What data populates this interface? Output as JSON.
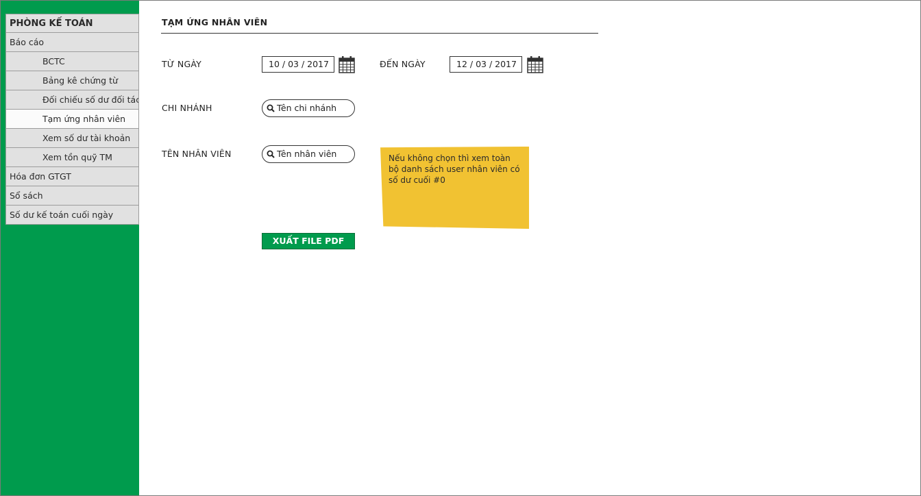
{
  "sidebar": {
    "items": [
      {
        "label": "PHÒNG KẾ TOÁN"
      },
      {
        "label": "Báo cáo"
      },
      {
        "label": "BCTC"
      },
      {
        "label": "Bảng kê chứng từ"
      },
      {
        "label": "Đối chiếu số dư đối tác"
      },
      {
        "label": "Tạm ứng nhân viên"
      },
      {
        "label": "Xem số dư tài khoản"
      },
      {
        "label": "Xem tồn quỹ TM"
      },
      {
        "label": "Hóa đơn GTGT"
      },
      {
        "label": "Sổ sách"
      },
      {
        "label": "Số dư kế toán cuối ngày"
      }
    ],
    "active": "Tạm ứng nhân viên"
  },
  "main": {
    "title": "TẠM ỨNG NHÂN VIÊN",
    "from_date": {
      "label": "TỪ NGÀY",
      "value": "10 / 03 / 2017"
    },
    "to_date": {
      "label": "ĐẾN NGÀY",
      "value": "12 / 03 / 2017"
    },
    "branch": {
      "label": "CHI NHÁNH",
      "placeholder": "Tên chi nhánh"
    },
    "employee": {
      "label": "TÊN NHÂN VIÊN",
      "placeholder": "Tên nhân viên"
    },
    "note": "Nếu không chọn thì xem toàn bộ danh sách user nhân viên có số dư cuối #0",
    "export_button": "XUẤT FILE PDF"
  },
  "colors": {
    "sidebar_bg": "#009b4d",
    "note_bg": "#f1c232",
    "button_bg": "#009b4d"
  },
  "icons": [
    "calendar-icon",
    "search-icon"
  ]
}
